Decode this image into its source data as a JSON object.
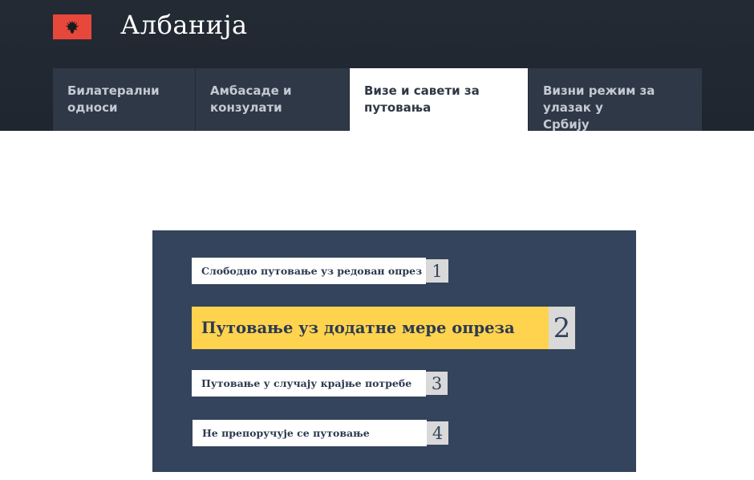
{
  "header": {
    "country": "Албанија",
    "flag_icon": "albania-flag-icon",
    "flag_color": "#e8473c"
  },
  "tabs": [
    {
      "label_line1": "Билатерални",
      "label_line2": "односи",
      "active": false
    },
    {
      "label_line1": "Амбасаде и",
      "label_line2": "конзулати",
      "active": false
    },
    {
      "label_line1": "Визе и савети за",
      "label_line2": "путовања",
      "active": true
    },
    {
      "label_line1": "Визни режим за улазак у",
      "label_line2": "Србију",
      "active": false
    }
  ],
  "levels": [
    {
      "number": "1",
      "text": "Слободно путовање уз редован опрез",
      "highlighted": false
    },
    {
      "number": "2",
      "text": "Путовање уз додатне мере опреза",
      "highlighted": true,
      "color": "#ffd34e"
    },
    {
      "number": "3",
      "text": "Путовање у случају крајње потребе",
      "highlighted": false
    },
    {
      "number": "4",
      "text": "Не препоручује се путовање",
      "highlighted": false
    }
  ]
}
